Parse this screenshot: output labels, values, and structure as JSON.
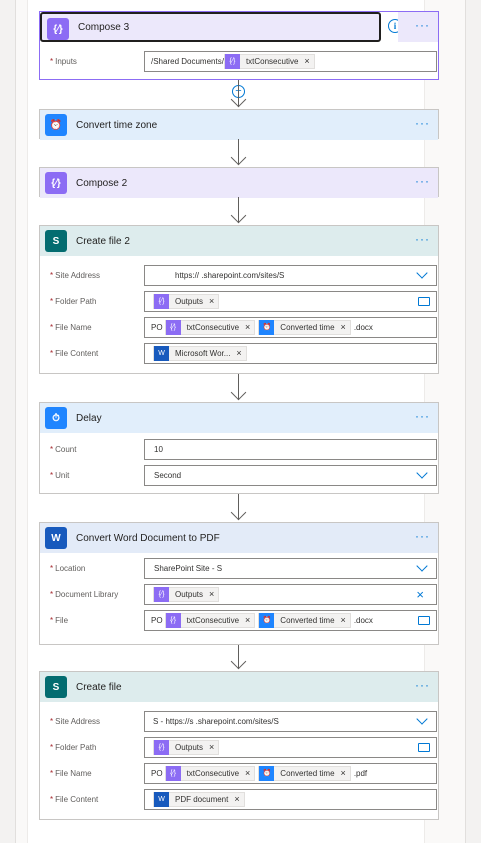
{
  "compose3": {
    "title": "Compose 3",
    "inputs_label": "Inputs",
    "inputs_prefix": "/Shared Documents/",
    "inputs_token": "txtConsecutive"
  },
  "convert_tz": {
    "title": "Convert time zone"
  },
  "compose2": {
    "title": "Compose 2"
  },
  "create_file2": {
    "title": "Create file 2",
    "site_label": "Site Address",
    "site_value": "https://          .sharepoint.com/sites/S",
    "folder_label": "Folder Path",
    "folder_token": "Outputs",
    "name_label": "File Name",
    "name_prefix": "PO",
    "name_token1": "txtConsecutive",
    "name_token2": "Converted time",
    "name_suffix": ".docx",
    "content_label": "File Content",
    "content_token": "Microsoft Wor..."
  },
  "delay": {
    "title": "Delay",
    "count_label": "Count",
    "count_value": "10",
    "unit_label": "Unit",
    "unit_value": "Second"
  },
  "convert_pdf": {
    "title": "Convert Word Document to PDF",
    "location_label": "Location",
    "location_value": "SharePoint Site - S",
    "library_label": "Document Library",
    "library_token": "Outputs",
    "file_label": "File",
    "file_prefix": "PO",
    "file_token1": "txtConsecutive",
    "file_token2": "Converted time",
    "file_suffix": ".docx"
  },
  "create_file": {
    "title": "Create file",
    "site_label": "Site Address",
    "site_value": "S       - https://s          .sharepoint.com/sites/S",
    "folder_label": "Folder Path",
    "folder_token": "Outputs",
    "name_label": "File Name",
    "name_prefix": "PO",
    "name_token1": "txtConsecutive",
    "name_token2": "Converted time",
    "name_suffix": ".pdf",
    "content_label": "File Content",
    "content_token": "PDF document"
  },
  "common": {
    "more": "···",
    "req": "*",
    "remove": "×",
    "info": "i",
    "add": "+"
  }
}
